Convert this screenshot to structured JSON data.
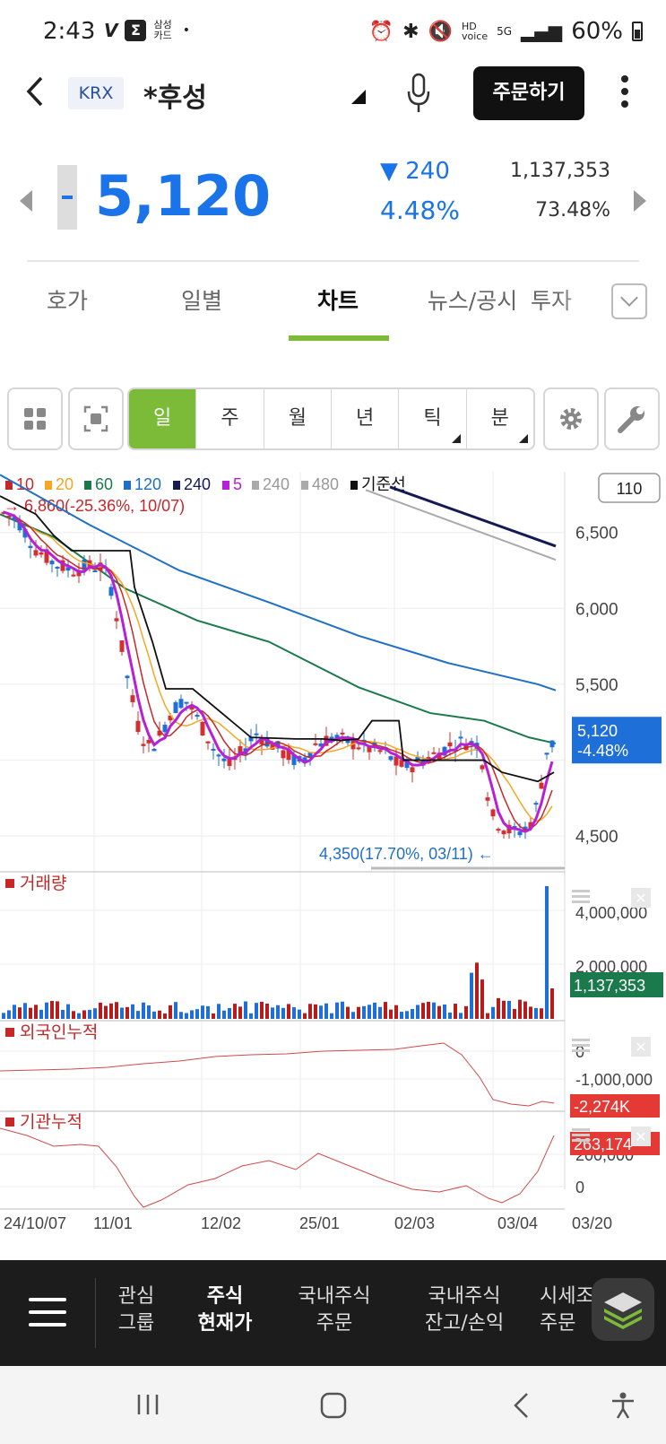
{
  "status_bar": {
    "time": "2:43",
    "left_icons": [
      "v-icon",
      "samsung-pay-icon"
    ],
    "samsung_card": "삼성\n카드",
    "dot": "•",
    "battery": "60%"
  },
  "header": {
    "market": "KRX",
    "stock_name": "*후성",
    "order_button": "주문하기"
  },
  "price": {
    "current": "5,120",
    "change": "▼ 240",
    "change_pct": "4.48%",
    "volume": "1,137,353",
    "ratio": "73.48%",
    "color": "#1a73e8"
  },
  "tabs": [
    {
      "label": "호가"
    },
    {
      "label": "일별"
    },
    {
      "label": "차트",
      "active": true
    },
    {
      "label": "뉴스/공시"
    },
    {
      "label": "투자"
    }
  ],
  "periods": [
    {
      "label": "일",
      "active": true
    },
    {
      "label": "주"
    },
    {
      "label": "월"
    },
    {
      "label": "년"
    },
    {
      "label": "틱",
      "corner": true
    },
    {
      "label": "분",
      "corner": true
    }
  ],
  "chart": {
    "legend": [
      {
        "label": "10",
        "color": "#c62828"
      },
      {
        "label": "20",
        "color": "#f5a623"
      },
      {
        "label": "60",
        "color": "#1b7a4b"
      },
      {
        "label": "120",
        "color": "#1f6fc5"
      },
      {
        "label": "240",
        "color": "#151a54"
      },
      {
        "label": "5",
        "color": "#b620d6"
      },
      {
        "label": "240",
        "color": "#aaaaaa"
      },
      {
        "label": "480",
        "color": "#aaaaaa"
      },
      {
        "label": "기준선",
        "color": "#111111"
      }
    ],
    "count_box": "110",
    "high_label": "→ 6,860(-25.36%, 10/07)",
    "low_label": "4,350(17.70%, 03/11) ←",
    "price_axis": [
      "6,500",
      "6,000",
      "5,500",
      "4,500"
    ],
    "current_label": "5,120",
    "current_pct": "-4.48%",
    "volume_title": "거래량",
    "volume_axis": [
      "4,000,000",
      "2,000,000"
    ],
    "volume_current": "1,137,353",
    "foreign_title": "외국인누적",
    "foreign_axis": [
      "0",
      "-1,000,000"
    ],
    "foreign_current": "-2,274K",
    "inst_title": "기관누적",
    "inst_axis": [
      "200,000",
      "0"
    ],
    "inst_current": "263,174",
    "date_axis": [
      "24/10/07",
      "11/01",
      "12/02",
      "25/01",
      "02/03",
      "03/04",
      "03/20"
    ]
  },
  "chart_data": {
    "type": "candlestick",
    "ylim": [
      4300,
      6900
    ],
    "ma_lines": [
      {
        "name": "120",
        "values": [
          [
            0,
            6880
          ],
          [
            100,
            6550
          ],
          [
            200,
            6250
          ],
          [
            300,
            6040
          ],
          [
            400,
            5820
          ],
          [
            500,
            5640
          ],
          [
            600,
            5500
          ],
          [
            620,
            5460
          ]
        ]
      },
      {
        "name": "60",
        "values": [
          [
            0,
            6620
          ],
          [
            60,
            6470
          ],
          [
            140,
            6130
          ],
          [
            220,
            5920
          ],
          [
            300,
            5780
          ],
          [
            400,
            5480
          ],
          [
            480,
            5310
          ],
          [
            540,
            5260
          ],
          [
            590,
            5150
          ],
          [
            620,
            5110
          ]
        ]
      },
      {
        "name": "240",
        "values": [
          [
            435,
            6800
          ],
          [
            620,
            6410
          ]
        ]
      },
      {
        "name": "480",
        "values": [
          [
            408,
            6780
          ],
          [
            620,
            6320
          ]
        ]
      }
    ],
    "high": {
      "value": 6860,
      "date": "10/07"
    },
    "low": {
      "value": 4350,
      "date": "03/11"
    },
    "last": 5120
  },
  "bottom_nav": {
    "items": [
      {
        "label": "관심\n그룹"
      },
      {
        "label": "주식\n현재가",
        "active": true
      },
      {
        "label": "국내주식\n주문"
      },
      {
        "label": "국내주식\n잔고/손익"
      },
      {
        "label": "시세조\n주문"
      }
    ]
  }
}
